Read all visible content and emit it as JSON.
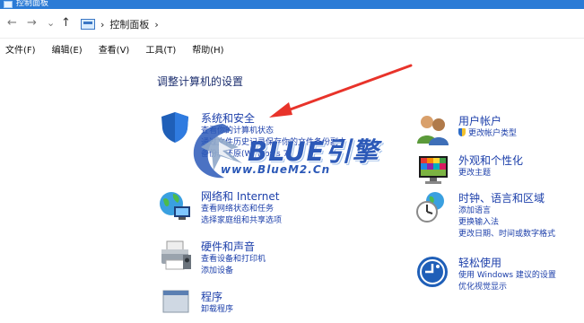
{
  "window": {
    "title": "控制面板"
  },
  "addressbar": {
    "back": "←",
    "forward": "→",
    "dropdown": "⌄",
    "up": "↑",
    "crumb_sep": "›",
    "crumb": "控制面板",
    "crumb_tail": "›"
  },
  "menu": [
    "文件(F)",
    "编辑(E)",
    "查看(V)",
    "工具(T)",
    "帮助(H)"
  ],
  "heading": "调整计算机的设置",
  "left": [
    {
      "title": "系统和安全",
      "links": [
        "查看你的计算机状态",
        "通过文件历史记录保存你的文件备份副本",
        "备份和还原(Windows 7)"
      ]
    },
    {
      "title": "网络和 Internet",
      "links": [
        "查看网络状态和任务",
        "选择家庭组和共享选项"
      ]
    },
    {
      "title": "硬件和声音",
      "links": [
        "查看设备和打印机",
        "添加设备"
      ]
    },
    {
      "title": "程序",
      "links": [
        "卸载程序"
      ]
    }
  ],
  "right": [
    {
      "title": "用户帐户",
      "links": [
        "更改帐户类型"
      ]
    },
    {
      "title": "外观和个性化",
      "links": [
        "更改主题"
      ]
    },
    {
      "title": "时钟、语言和区域",
      "links": [
        "添加语言",
        "更换输入法",
        "更改日期、时间或数字格式"
      ]
    },
    {
      "title": "轻松使用",
      "links": [
        "使用 Windows 建议的设置",
        "优化视觉显示"
      ]
    }
  ],
  "watermark": {
    "title": "BLUE引擎",
    "url": "www.BlueM2.Cn"
  },
  "colors": {
    "link": "#1c3faa",
    "heading": "#1d2f6f",
    "arrow": "#e8332a",
    "titlebar": "#2b7bd6",
    "watermark": "#2c59b8"
  }
}
